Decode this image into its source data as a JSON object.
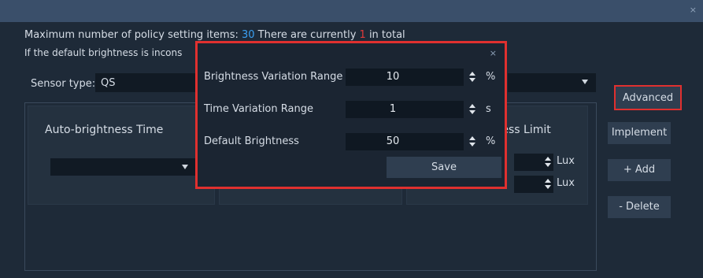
{
  "window": {
    "close_glyph": "×"
  },
  "info": {
    "line1_prefix": "Maximum number of policy setting items: ",
    "max_items": "30",
    "line1_mid": " There are currently ",
    "current_count": "1",
    "line1_suffix": " in total",
    "line2": "If the default brightness is incons"
  },
  "sensor": {
    "label": "Sensor type:",
    "value": "QS"
  },
  "columns": {
    "col1_title": "Auto-brightness Time",
    "col3_title": "tness Limit"
  },
  "lux": {
    "unit1": "Lux",
    "unit2": "Lux"
  },
  "buttons": {
    "advanced": "Advanced",
    "implement": "Implement",
    "add": "+ Add",
    "delete": "- Delete"
  },
  "dialog": {
    "close_glyph": "×",
    "rows": [
      {
        "label": "Brightness Variation Range",
        "value": "10",
        "unit": "%"
      },
      {
        "label": "Time Variation Range",
        "value": "1",
        "unit": "s"
      },
      {
        "label": "Default Brightness",
        "value": "50",
        "unit": "%"
      }
    ],
    "save": "Save"
  },
  "colors": {
    "accent_blue": "#3aa0f2",
    "accent_red": "#e03a3a",
    "highlight_border": "#e0302f"
  }
}
